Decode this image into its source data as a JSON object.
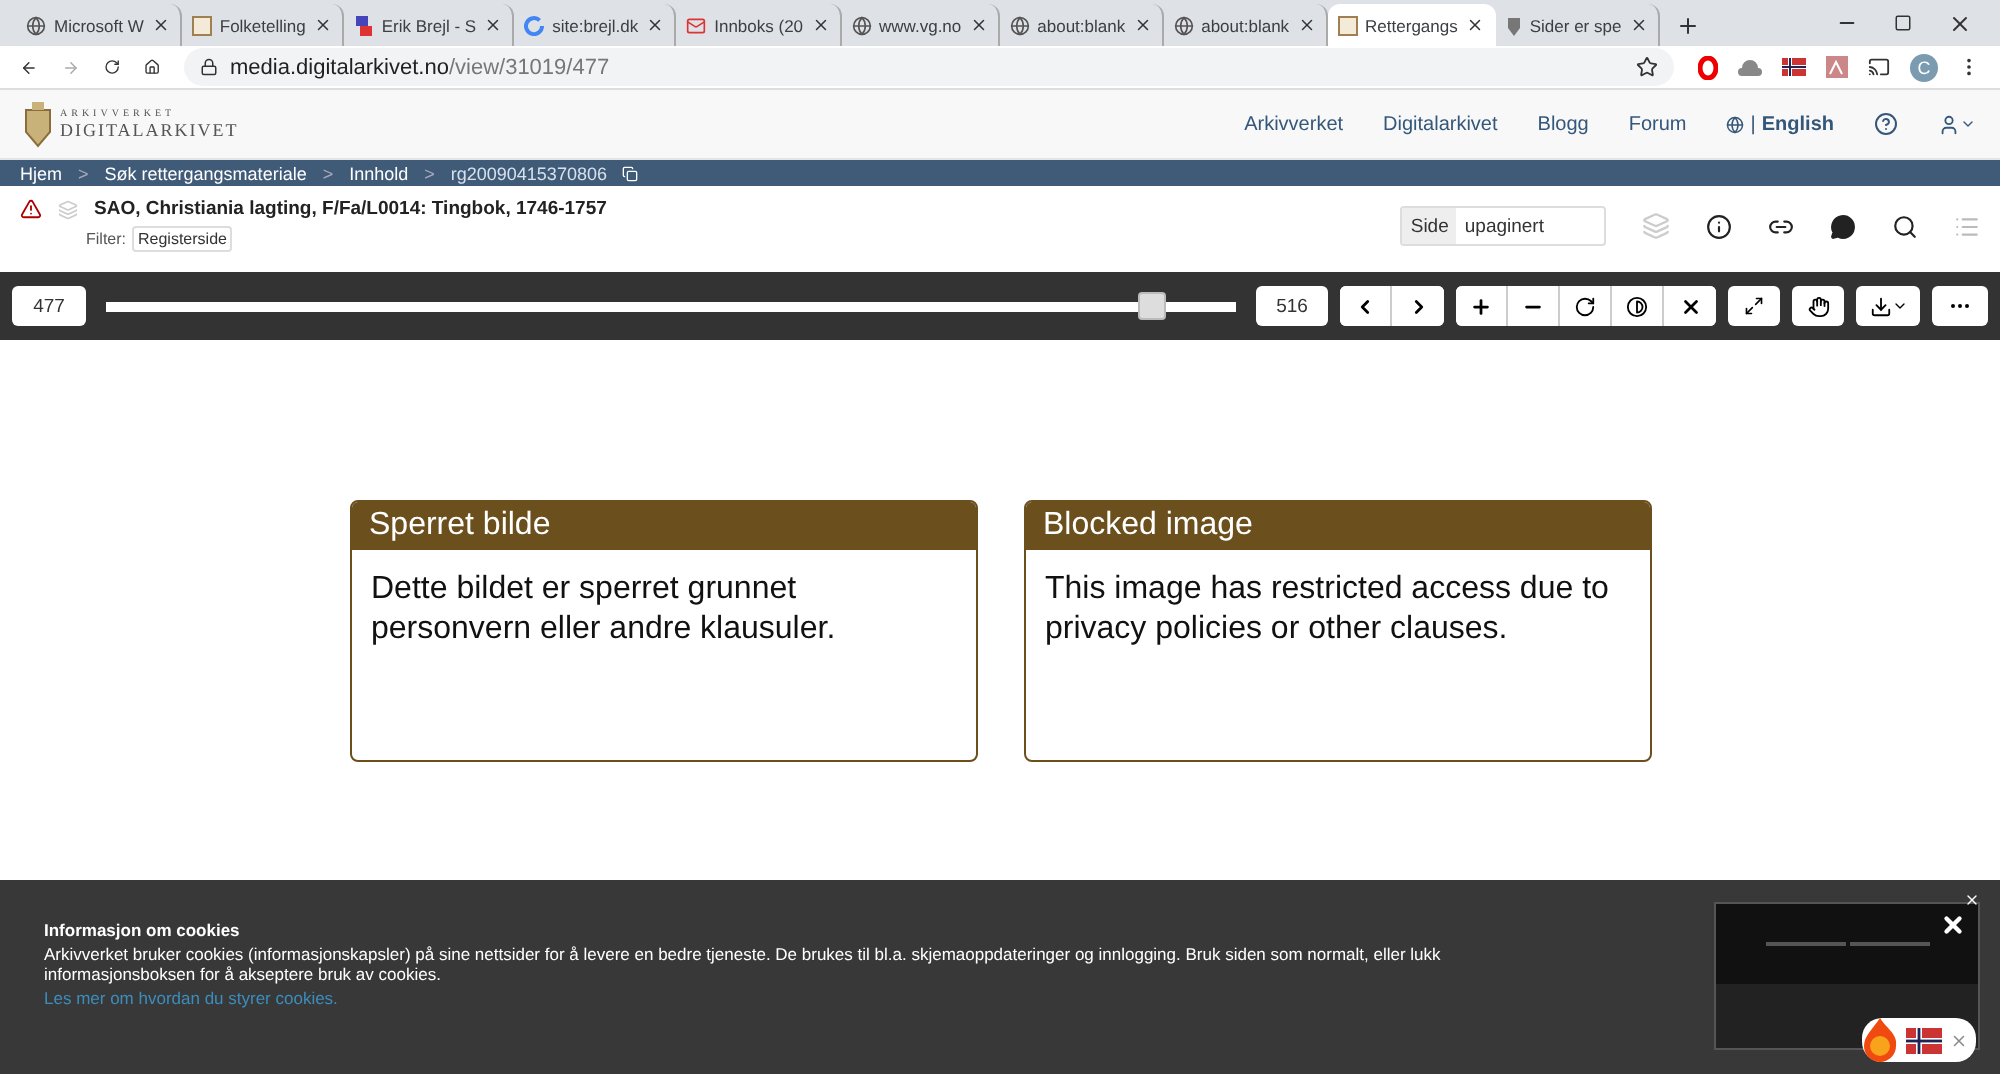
{
  "browser": {
    "tabs": [
      {
        "title": "Microsoft W",
        "selected": false
      },
      {
        "title": "Folketelling",
        "selected": false
      },
      {
        "title": "Erik Brejl - S",
        "selected": false
      },
      {
        "title": "site:brejl.dk",
        "selected": false
      },
      {
        "title": "Innboks (20",
        "selected": false
      },
      {
        "title": "www.vg.no",
        "selected": false
      },
      {
        "title": "about:blank",
        "selected": false
      },
      {
        "title": "about:blank",
        "selected": false
      },
      {
        "title": "Rettergangs",
        "selected": true
      },
      {
        "title": "Sider er spe",
        "selected": false
      }
    ],
    "address": {
      "host": "media.digitalarkivet.no",
      "path": "/view/31019/477"
    },
    "profile_initial": "C"
  },
  "site": {
    "logo": {
      "small": "ARKIVVERKET",
      "large": "DIGITALARKIVET"
    },
    "nav": [
      "Arkivverket",
      "Digitalarkivet",
      "Blogg",
      "Forum"
    ],
    "language_separator": "|",
    "language": "English",
    "breadcrumbs": [
      "Hjem",
      "Søk rettergangsmateriale",
      "Innhold",
      "rg20090415370806"
    ],
    "breadcrumb_separators": [
      ">",
      ">",
      ">"
    ],
    "title": "SAO, Christiania lagting, F/Fa/L0014: Tingbok, 1746-1757",
    "filter": {
      "label": "Filter:",
      "value": "Registerside"
    },
    "page_field": {
      "label": "Side",
      "value": "upaginert"
    }
  },
  "viewer": {
    "current_page": "477",
    "total_pages": "516",
    "slider": {
      "level": 0.925
    },
    "blocked": [
      {
        "title": "Sperret bilde",
        "text": "Dette bildet er sperret grunnet personvern eller andre klausuler."
      },
      {
        "title": "Blocked image",
        "text": "This image has restricted access due to privacy policies or other clauses."
      }
    ]
  },
  "cookies": {
    "title": "Informasjon om cookies",
    "text": "Arkivverket bruker cookies (informasjonskapsler) på sine nettsider for å levere en bedre tjeneste. De brukes til bl.a. skjemaoppdateringer og innlogging. Bruk siden som normalt, eller lukk informasjonsboksen for å akseptere bruk av cookies.",
    "link": "Les mer om hvordan du styrer cookies."
  }
}
